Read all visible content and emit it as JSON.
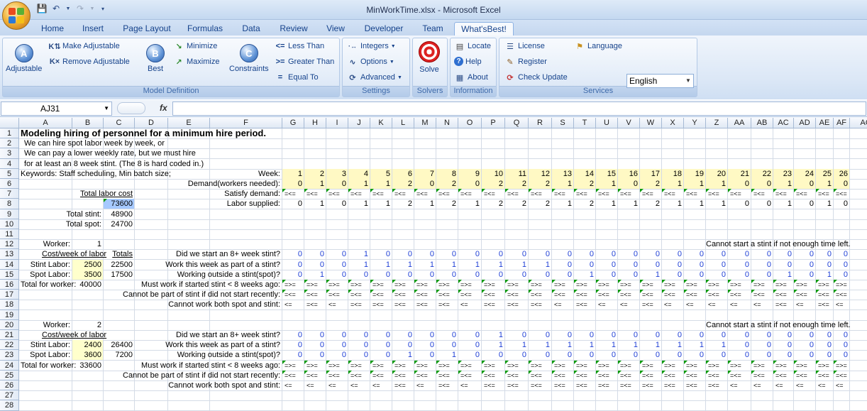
{
  "window": {
    "title": "MinWorkTime.xlsx - Microsoft Excel"
  },
  "colors": {
    "accent": "#15428b",
    "input_fill": "#ffffcc",
    "triangle": "#0b9a0b"
  },
  "tabs": [
    "Home",
    "Insert",
    "Page Layout",
    "Formulas",
    "Data",
    "Review",
    "View",
    "Developer",
    "Team",
    "What'sBest!"
  ],
  "ribbon": {
    "adjustable": "Adjustable",
    "make_adjustable": "Make Adjustable",
    "remove_adjustable": "Remove Adjustable",
    "best": "Best",
    "minimize": "Minimize",
    "maximize": "Maximize",
    "constraints": "Constraints",
    "less_than": "Less Than",
    "greater_than": "Greater Than",
    "equal_to": "Equal To",
    "group_model": "Model Definition",
    "integers": "Integers",
    "options": "Options",
    "advanced": "Advanced",
    "group_settings": "Settings",
    "solve": "Solve",
    "group_solvers": "Solvers",
    "locate": "Locate",
    "help": "Help",
    "about": "About",
    "group_info": "Information",
    "license": "License",
    "register": "Register",
    "check_update": "Check Update",
    "language": "Language",
    "language_value": "English",
    "group_services": "Services"
  },
  "namebox": "AJ31",
  "fx": "fx",
  "columns": [
    "A",
    "B",
    "C",
    "D",
    "E",
    "F",
    "G",
    "H",
    "I",
    "J",
    "K",
    "L",
    "M",
    "N",
    "O",
    "P",
    "Q",
    "R",
    "S",
    "T",
    "U",
    "V",
    "W",
    "X",
    "Y",
    "Z",
    "AA",
    "AB",
    "AC",
    "AD",
    "AE",
    "AF",
    "AG"
  ],
  "rows": [
    "1",
    "2",
    "3",
    "4",
    "5",
    "6",
    "7",
    "8",
    "9",
    "10",
    "11",
    "12",
    "13",
    "14",
    "15",
    "16",
    "17",
    "18",
    "19",
    "20",
    "21",
    "22",
    "23",
    "24",
    "25",
    "26",
    "27",
    "28"
  ],
  "sheet": {
    "r1": "Modeling hiring of personnel for a minimum hire period.",
    "r2": "We can hire spot labor week by week, or",
    "r3": "We can pay a lower weekly rate, but we must hire",
    "r4": "for at least an 8 week stint. (The 8 is hard coded in.)",
    "keywords": "Keywords: Staff scheduling, Min batch size;",
    "week_label": "Week:",
    "demand_label": "Demand(workers needed):",
    "satisfy_label": "Satisfy demand:",
    "supplied_label": "Labor supplied:",
    "total_labor_cost_label": "Total labor cost",
    "total_labor_cost": "73600",
    "total_stint_label": "Total stint:",
    "total_stint": "48900",
    "total_spot_label": "Total spot:",
    "total_spot": "24700",
    "weeks": [
      "1",
      "2",
      "3",
      "4",
      "5",
      "6",
      "7",
      "8",
      "9",
      "10",
      "11",
      "12",
      "13",
      "14",
      "15",
      "16",
      "17",
      "18",
      "19",
      "20",
      "21",
      "22",
      "23",
      "24",
      "25",
      "26"
    ],
    "demand": [
      "0",
      "1",
      "0",
      "1",
      "1",
      "2",
      "0",
      "2",
      "0",
      "2",
      "2",
      "2",
      "1",
      "2",
      "1",
      "0",
      "2",
      "1",
      "1",
      "1",
      "0",
      "0",
      "1",
      "0",
      "1",
      "0"
    ],
    "satisfy": [
      "=<=",
      "=<=",
      "=<=",
      "=<=",
      "=<=",
      "=<=",
      "=<=",
      "=<=",
      "=<=",
      "=<=",
      "=<=",
      "=<=",
      "=<=",
      "=<=",
      "=<=",
      "=<=",
      "=<=",
      "=<=",
      "=<=",
      "=<=",
      "=<=",
      "=<=",
      "=<=",
      "=<=",
      "=<=",
      "=<="
    ],
    "supplied": [
      "0",
      "1",
      "0",
      "1",
      "1",
      "2",
      "1",
      "2",
      "1",
      "2",
      "2",
      "2",
      "1",
      "2",
      "1",
      "1",
      "2",
      "1",
      "1",
      "1",
      "0",
      "0",
      "1",
      "0",
      "1",
      "0"
    ],
    "workers": [
      {
        "worker_label": "Worker:",
        "worker_num": "1",
        "cost_label": "Cost/week of labor",
        "totals_label": "Totals",
        "stint_label": "Stint Labor:",
        "stint_cost": "2500",
        "stint_total": "22500",
        "spot_label": "Spot Labor:",
        "spot_cost": "3500",
        "spot_total": "17500",
        "total_label": "Total for worker:",
        "total": "40000",
        "q1": "Did we start an 8+ week stint?",
        "q2": "Work this week as part of a stint?",
        "q3": "Working outside a stint(spot)?",
        "c1": "Must work if started stint < 8 weeks ago:",
        "c2": "Cannot be part of stint if did not start recently:",
        "c3": "Cannot work both spot and stint:",
        "note": "Cannot start a stint if not enough time left.",
        "start": [
          "0",
          "0",
          "0",
          "1",
          "0",
          "0",
          "0",
          "0",
          "0",
          "0",
          "0",
          "0",
          "0",
          "0",
          "0",
          "0",
          "0",
          "0",
          "0",
          "0",
          "0",
          "0",
          "0",
          "0",
          "0",
          "0"
        ],
        "stint": [
          "0",
          "0",
          "0",
          "1",
          "1",
          "1",
          "1",
          "1",
          "1",
          "1",
          "1",
          "1",
          "0",
          "0",
          "0",
          "0",
          "0",
          "0",
          "0",
          "0",
          "0",
          "0",
          "0",
          "0",
          "0",
          "0"
        ],
        "spot": [
          "0",
          "1",
          "0",
          "0",
          "0",
          "0",
          "0",
          "0",
          "0",
          "0",
          "0",
          "0",
          "0",
          "1",
          "0",
          "0",
          "1",
          "0",
          "0",
          "0",
          "0",
          "0",
          "1",
          "0",
          "1",
          "0"
        ],
        "row16": [
          "=>=",
          "=>=",
          "=>=",
          "=>=",
          "=>=",
          "=>=",
          "=>=",
          "=>=",
          "=>=",
          "=>=",
          "=>=",
          "=>=",
          "=>=",
          "=>=",
          "=>=",
          "=>=",
          "=>=",
          "=>=",
          "=>=",
          "=>=",
          "=>=",
          "=>=",
          "=>=",
          "=>=",
          "=>=",
          "=>="
        ],
        "row17": [
          "=<=",
          "=<=",
          "=<=",
          "=<=",
          "=<=",
          "=<=",
          "=<=",
          "=<=",
          "=<=",
          "=<=",
          "=<=",
          "=<=",
          "=<=",
          "=<=",
          "=<=",
          "=<=",
          "=<=",
          "=<=",
          "=<=",
          "=<=",
          "=<=",
          "=<=",
          "=<=",
          "=<=",
          "=<=",
          "=<="
        ],
        "row18": [
          "<=",
          "=<=",
          "<=",
          "=<=",
          "=<=",
          "=<=",
          "=<=",
          "=<=",
          "<=",
          "=<=",
          "=<=",
          "=<=",
          "<=",
          "=<=",
          "<=",
          "<=",
          "=<=",
          "<=",
          "<=",
          "<=",
          "<=",
          "<=",
          "=<=",
          "<=",
          "=<=",
          "<="
        ]
      },
      {
        "worker_label": "Worker:",
        "worker_num": "2",
        "cost_label": "Cost/week of labor",
        "totals_label": "",
        "stint_label": "Stint Labor:",
        "stint_cost": "2400",
        "stint_total": "26400",
        "spot_label": "Spot Labor:",
        "spot_cost": "3600",
        "spot_total": "7200",
        "total_label": "Total for worker:",
        "total": "33600",
        "q1": "Did we start an 8+ week stint?",
        "q2": "Work this week as part of a stint?",
        "q3": "Working outside a stint(spot)?",
        "c1": "Must work if started stint < 8 weeks ago:",
        "c2": "Cannot be part of stint if did not start recently:",
        "c3": "Cannot work both spot and stint:",
        "note": "Cannot start a stint if not enough time left.",
        "start": [
          "0",
          "0",
          "0",
          "0",
          "0",
          "0",
          "0",
          "0",
          "0",
          "1",
          "0",
          "0",
          "0",
          "0",
          "0",
          "0",
          "0",
          "0",
          "0",
          "0",
          "0",
          "0",
          "0",
          "0",
          "0",
          "0"
        ],
        "stint": [
          "0",
          "0",
          "0",
          "0",
          "0",
          "0",
          "0",
          "0",
          "0",
          "1",
          "1",
          "1",
          "1",
          "1",
          "1",
          "1",
          "1",
          "1",
          "1",
          "1",
          "0",
          "0",
          "0",
          "0",
          "0",
          "0"
        ],
        "spot": [
          "0",
          "0",
          "0",
          "0",
          "0",
          "1",
          "0",
          "1",
          "0",
          "0",
          "0",
          "0",
          "0",
          "0",
          "0",
          "0",
          "0",
          "0",
          "0",
          "0",
          "0",
          "0",
          "0",
          "0",
          "0",
          "0"
        ],
        "row16": [
          "=>=",
          "=>=",
          "=>=",
          "=>=",
          "=>=",
          "=>=",
          "=>=",
          "=>=",
          "=>=",
          "=>=",
          "=>=",
          "=>=",
          "=>=",
          "=>=",
          "=>=",
          "=>=",
          "=>=",
          "=>=",
          "=>=",
          "=>=",
          "=>=",
          "=>=",
          "=>=",
          "=>=",
          "=>=",
          "=>="
        ],
        "row17": [
          "=<=",
          "=<=",
          "=<=",
          "=<=",
          "=<=",
          "=<=",
          "=<=",
          "=<=",
          "=<=",
          "=<=",
          "=<=",
          "=<=",
          "=<=",
          "=<=",
          "=<=",
          "=<=",
          "=<=",
          "=<=",
          "=<=",
          "=<=",
          "=<=",
          "=<=",
          "=<=",
          "=<=",
          "=<=",
          "=<="
        ],
        "row18": [
          "<=",
          "<=",
          "<=",
          "<=",
          "<=",
          "=<=",
          "<=",
          "=<=",
          "<=",
          "=<=",
          "=<=",
          "=<=",
          "=<=",
          "=<=",
          "=<=",
          "=<=",
          "=<=",
          "=<=",
          "=<=",
          "=<=",
          "<=",
          "<=",
          "<=",
          "<=",
          "<=",
          "<="
        ]
      }
    ]
  }
}
